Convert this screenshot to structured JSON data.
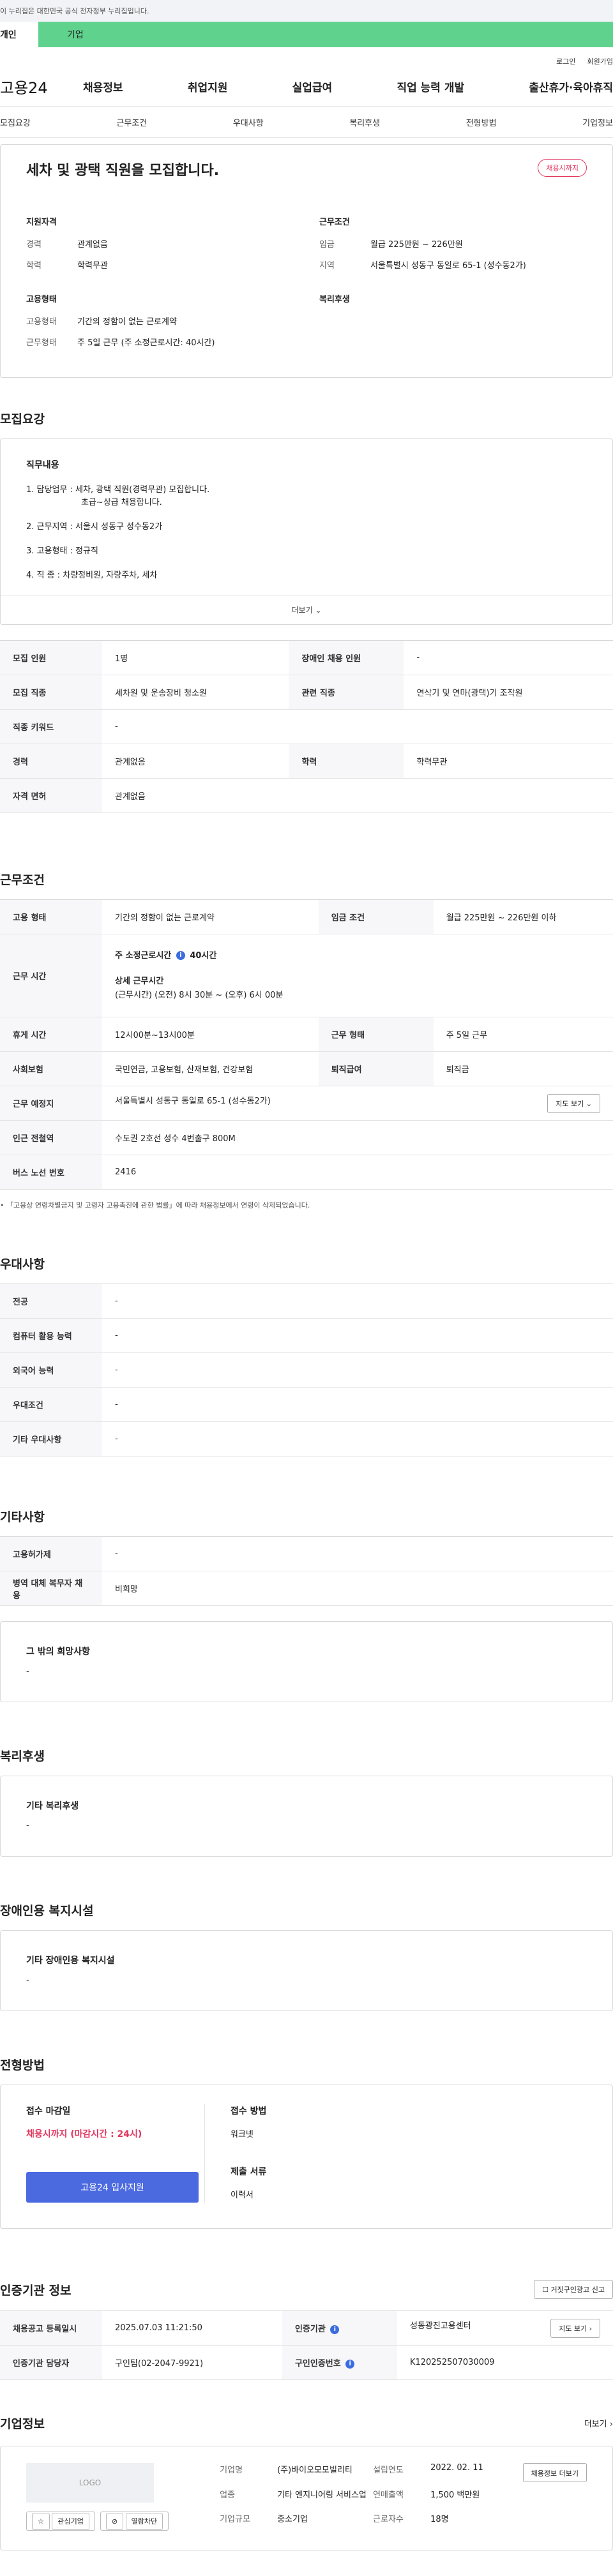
{
  "gov_notice": "이 누리집은 대한민국 공식 전자정부 누리집입니다.",
  "tabs": {
    "individual": "개인",
    "company": "기업"
  },
  "util": {
    "login": "로그인",
    "join": "회원가입"
  },
  "logo": "고용24",
  "gnb": [
    "채용정보",
    "취업지원",
    "실업급여",
    "직업 능력 개발",
    "출산휴가·육아휴직"
  ],
  "snb": [
    "모집요강",
    "근무조건",
    "우대사항",
    "복리후생",
    "전형방법",
    "기업정보"
  ],
  "summary": {
    "title": "세차 및 광택 직원을 모집합니다.",
    "badge": "채용시까지",
    "qual_title": "지원자격",
    "career_k": "경력",
    "career_v": "관계없음",
    "edu_k": "학력",
    "edu_v": "학력무관",
    "cond_title": "근무조건",
    "wage_k": "임금",
    "wage_v": "월급 225만원 ~ 226만원",
    "region_k": "지역",
    "region_v": "서울특별시 성동구 동일로 65-1 (성수동2가)",
    "emp_title": "고용형태",
    "emptype_k": "고용형태",
    "emptype_v": "기간의 정함이 없는 근로계약",
    "worktype_k": "근무형태",
    "worktype_v": "주 5일 근무 (주 소정근로시간: 40시간)",
    "welfare_title": "복리후생"
  },
  "recruit": {
    "title": "모집요강",
    "job_title": "직무내용",
    "lines": [
      "1. 담당업무 :  세차, 광택 직원(경력무관) 모집합니다.",
      "초급~상급 채용합니다.",
      "2. 근무지역 : 서울시 성동구 성수동2가",
      "3. 고용형태 : 정규직",
      "4. 직  종 : 차량정비원, 자량주차, 세차"
    ],
    "more": "더보기",
    "table": {
      "headcount_k": "모집 인원",
      "headcount_v": "1명",
      "disabled_k": "장애인 채용 인원",
      "disabled_v": "-",
      "jobtype_k": "모집 직종",
      "jobtype_v": "세차원 및 운송장비 청소원",
      "related_k": "관련 직종",
      "related_v": "연삭기 및 연마(광택)기 조작원",
      "keyword_k": "직종 키워드",
      "keyword_v": "-",
      "career_k": "경력",
      "career_v": "관계없음",
      "edu_k": "학력",
      "edu_v": "학력무관",
      "license_k": "자격 면허",
      "license_v": "관계없음"
    }
  },
  "work": {
    "title": "근무조건",
    "emptype_k": "고용 형태",
    "emptype_v": "기간의 정함이 없는 근로계약",
    "wage_k": "임금 조건",
    "wage_v": "월급 225만원 ~ 226만원 이하",
    "time_k": "근무 시간",
    "time_v1": "주 소정근로시간",
    "time_v1b": "40시간",
    "time_v2": "상세 근무시간",
    "time_v3": "(근무시간) (오전) 8시 30분 ~ (오후) 6시 00분",
    "break_k": "휴게 시간",
    "break_v": "12시00분~13시00분",
    "form_k": "근무 형태",
    "form_v": "주 5일 근무",
    "insurance_k": "사회보험",
    "insurance_v": "국민연금, 고용보험, 산재보험, 건강보험",
    "retire_k": "퇴직급여",
    "retire_v": "퇴직금",
    "place_k": "근무 예정지",
    "place_v": "서울특별시 성동구 동일로 65-1 (성수동2가)",
    "map_btn": "지도 보기",
    "subway_k": "인근 전철역",
    "subway_v": "수도권 2호선 성수 4번출구 800M",
    "bus_k": "버스 노선 번호",
    "bus_v": "2416",
    "note": "「고용상 연령차별금지 및 고령자 고용촉진에 관한 법률」에 따라 채용정보에서 연령이 삭제되었습니다."
  },
  "prefer": {
    "title": "우대사항",
    "rows": [
      {
        "k": "전공",
        "v": "-"
      },
      {
        "k": "컴퓨터 활용 능력",
        "v": "-"
      },
      {
        "k": "외국어 능력",
        "v": "-"
      },
      {
        "k": "우대조건",
        "v": "-"
      },
      {
        "k": "기타 우대사항",
        "v": "-"
      }
    ]
  },
  "etc": {
    "title": "기타사항",
    "rows": [
      {
        "k": "고용허가제",
        "v": "-"
      },
      {
        "k": "병역 대체 복무자 채용",
        "v": "비희망"
      }
    ],
    "box_title": "그 밖의 희망사항",
    "box_value": "-"
  },
  "welfare": {
    "title": "복리후생",
    "box_title": "기타 복리후생",
    "box_value": "-"
  },
  "disabled": {
    "title": "장애인용 복지시설",
    "box_title": "기타 장애인용 복지시설",
    "box_value": "-"
  },
  "selection": {
    "title": "전형방법",
    "deadline_k": "접수 마감일",
    "deadline_v": "채용시까지 (마감시간 : 24시)",
    "apply_btn": "고용24 입사지원",
    "method_k": "접수 방법",
    "method_v": "워크넷",
    "docs_k": "제출 서류",
    "docs_v": "이력서"
  },
  "institution": {
    "title": "인증기관 정보",
    "report_btn": "거짓구인광고 신고",
    "reg_k": "채용공고 등록일시",
    "reg_v": "2025.07.03 11:21:50",
    "inst_k": "인증기관",
    "inst_v": "성동광진고용센터",
    "map_btn": "지도 보기",
    "staff_k": "인증기관 담당자",
    "staff_v": "구인팀(02-2047-9921)",
    "no_k": "구인인증번호",
    "no_v": "K120252507030009"
  },
  "company": {
    "title": "기업정보",
    "more": "더보기",
    "logo": "LOGO",
    "fav_btn": "관심기업",
    "block_btn": "열람차단",
    "name_k": "기업명",
    "name_v": "(주)바이오모모빌리티",
    "industry_k": "업종",
    "industry_v": "기타 엔지니어링 서비스업",
    "size_k": "기업규모",
    "size_v": "중소기업",
    "founded_k": "설립연도",
    "founded_v": "2022. 02. 11",
    "sales_k": "연매출액",
    "sales_v": "1,500 백만원",
    "staff_k": "근로자수",
    "staff_v": "18명",
    "side_btn": "채용정보 더보기"
  }
}
